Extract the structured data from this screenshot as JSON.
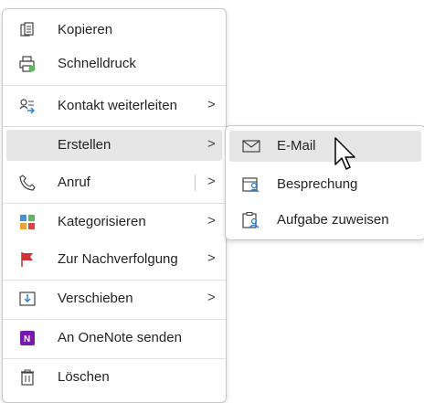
{
  "menu": {
    "items": [
      {
        "label": "Kopieren",
        "icon": "copy-icon"
      },
      {
        "label": "Schnelldruck",
        "icon": "quick-print-icon"
      },
      {
        "label": "Kontakt weiterleiten",
        "icon": "forward-contact-icon"
      },
      {
        "label": "Erstellen",
        "icon": ""
      },
      {
        "label": "Anruf",
        "icon": "phone-icon"
      },
      {
        "label": "Kategorisieren",
        "icon": "categorize-icon"
      },
      {
        "label": "Zur Nachverfolgung",
        "icon": "flag-icon"
      },
      {
        "label": "Verschieben",
        "icon": "move-icon"
      },
      {
        "label": "An OneNote senden",
        "icon": "onenote-icon"
      },
      {
        "label": "Löschen",
        "icon": "trash-icon"
      }
    ],
    "chevron": ">"
  },
  "submenu": {
    "items": [
      {
        "label": "E-Mail",
        "icon": "mail-icon"
      },
      {
        "label": "Besprechung",
        "icon": "meeting-icon"
      },
      {
        "label": "Aufgabe zuweisen",
        "icon": "task-assign-icon"
      }
    ]
  },
  "colors": {
    "highlight": "#e6e6e6",
    "border": "#c8c8c8",
    "categorize": [
      "#4a90d9",
      "#5bb85b",
      "#e8a33d",
      "#d64545"
    ],
    "flag": "#d13438",
    "onenote": "#7719aa",
    "accent_blue": "#2b7cd3"
  }
}
